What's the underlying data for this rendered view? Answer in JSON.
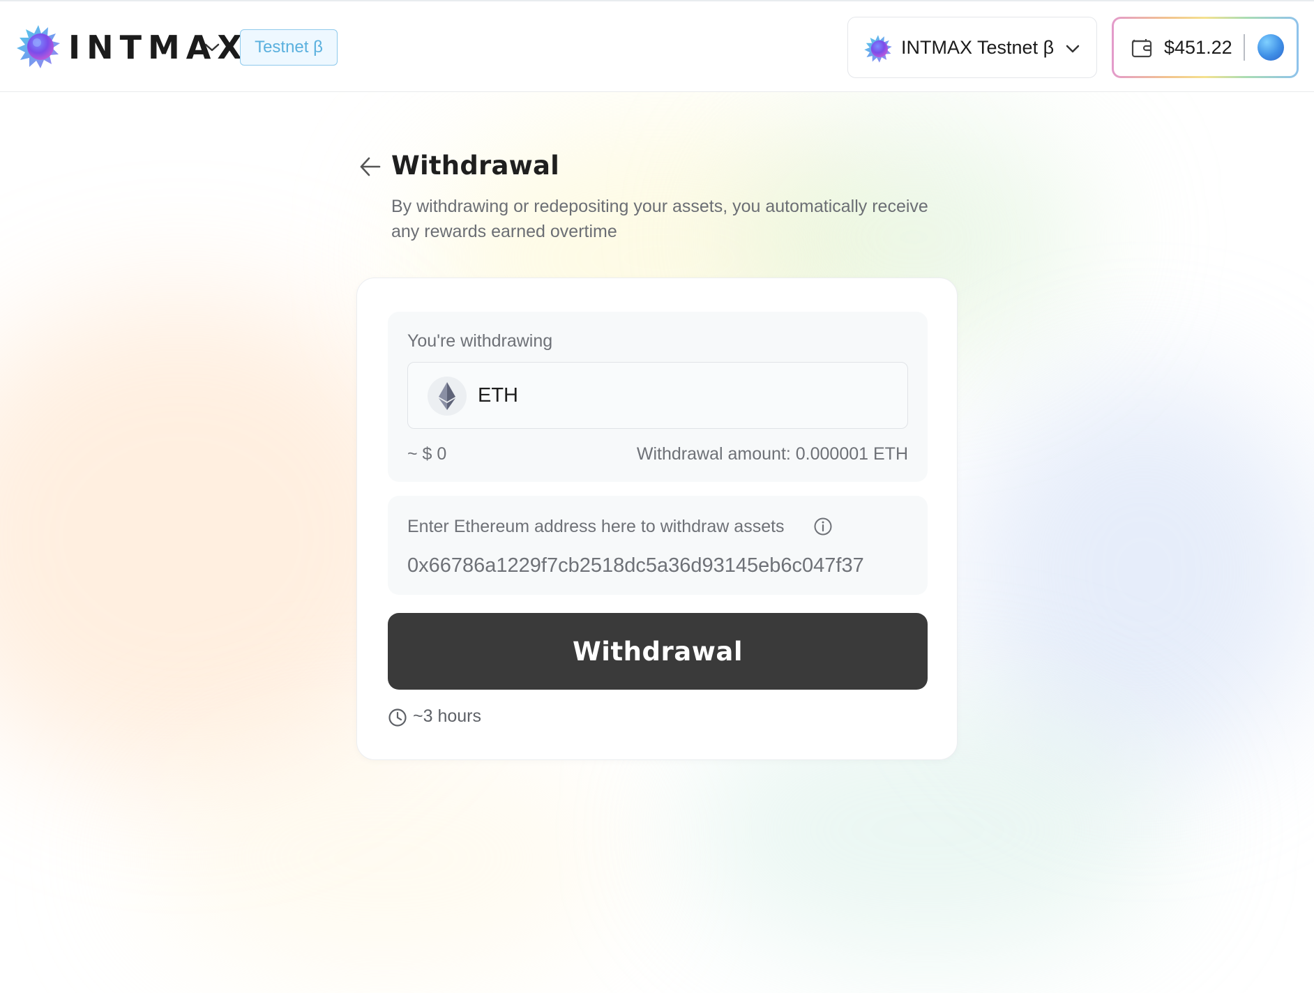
{
  "header": {
    "brand": "INTMAX",
    "env_badge": "Testnet β",
    "network_label": "INTMAX Testnet β",
    "wallet_balance": "$451.22"
  },
  "page": {
    "title": "Withdrawal",
    "subtitle": "By withdrawing or redepositing your assets, you automatically receive any rewards earned overtime"
  },
  "form": {
    "amount_label": "You're withdrawing",
    "token_symbol": "ETH",
    "usd_value": "~ $ 0",
    "withdraw_amount": "Withdrawal amount: 0.000001 ETH",
    "address_label": "Enter Ethereum address here to withdraw assets",
    "address_value": "0x66786a1229f7cb2518dc5a36d93145eb6c047f37",
    "submit_label": "Withdrawal",
    "eta": "~3 hours"
  },
  "icons": {
    "logo": "intmax-logo-icon",
    "chevron": "chevron-down-icon",
    "wallet": "wallet-icon",
    "back": "arrow-left-icon",
    "eth": "ethereum-icon",
    "info": "info-icon",
    "clock": "clock-icon"
  },
  "colors": {
    "badge_border": "#8ec9ec",
    "badge_text": "#5ab0de",
    "button_bg": "#3a3a3a",
    "panel_bg": "#f7f9fa"
  }
}
